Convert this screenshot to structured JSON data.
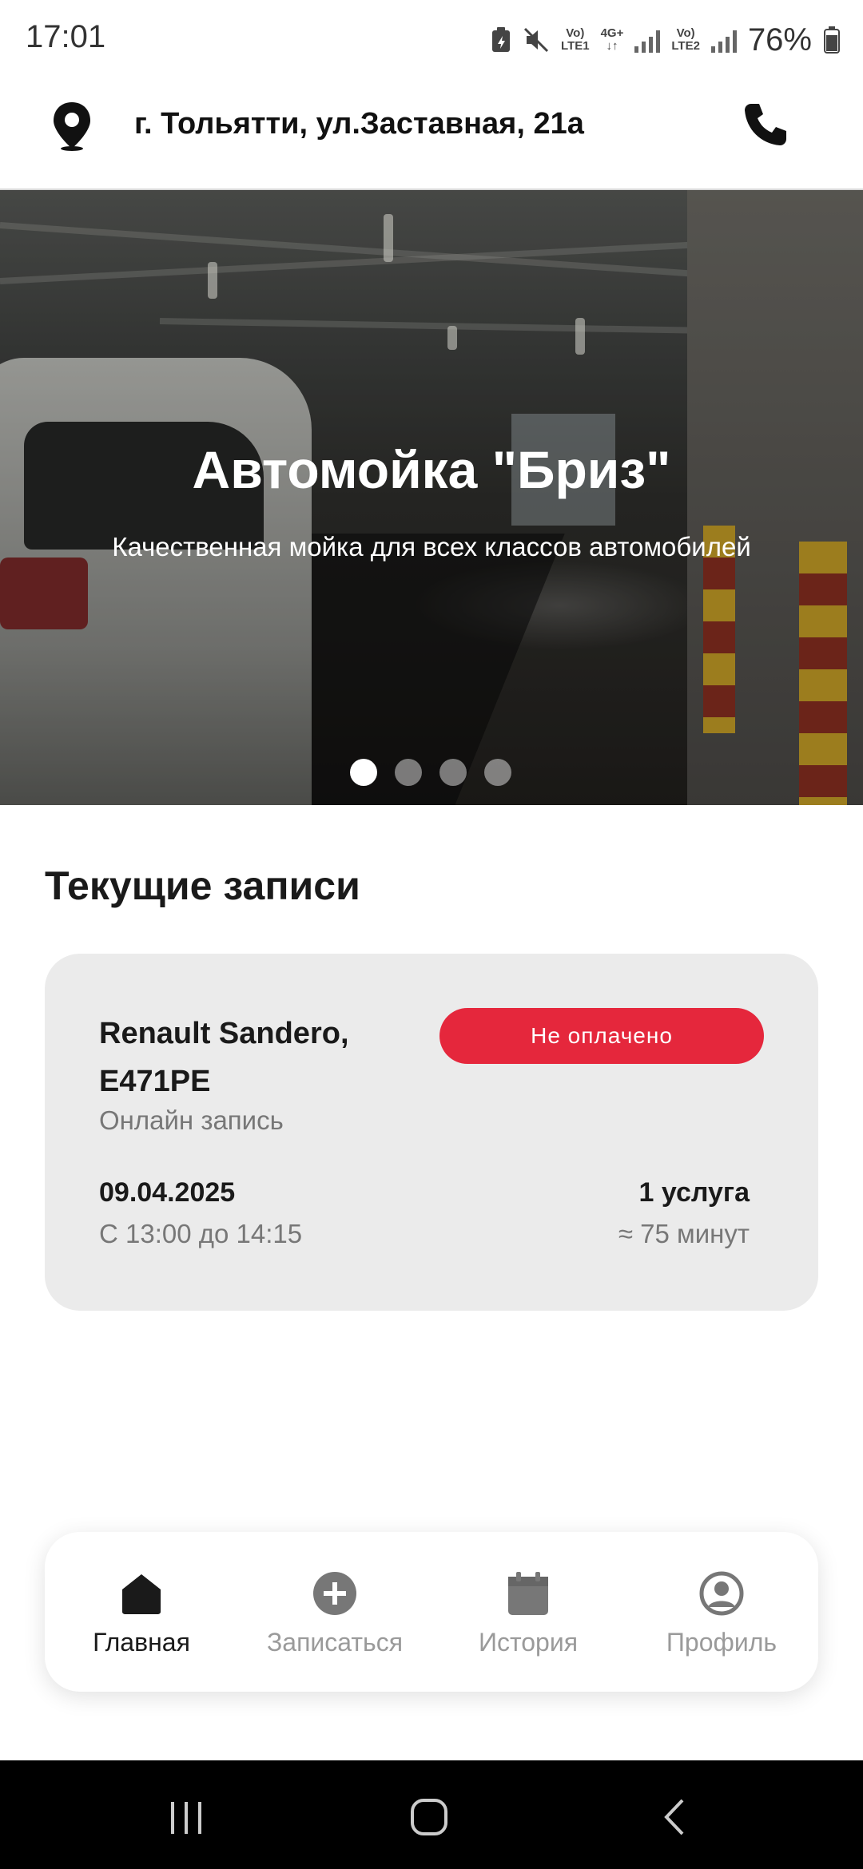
{
  "status_bar": {
    "time": "17:01",
    "net1_top": "Vo)",
    "net1_bottom": "LTE1",
    "net_mid_top": "4G+",
    "net_mid_bottom": "↓↑",
    "net2_top": "Vo)",
    "net2_bottom": "LTE2",
    "battery": "76%",
    "icons": [
      "battery-saver-icon",
      "mute-icon",
      "signal-icon",
      "battery-icon"
    ]
  },
  "header": {
    "address": "г. Тольятти, ул.Заставная, 21а",
    "location_icon": "map-pin-icon",
    "phone_icon": "phone-icon"
  },
  "hero": {
    "title": "Автомойка \"Бриз\"",
    "subtitle": "Качественная мойка для всех классов автомобилей",
    "slides_total": 4,
    "active_slide": 1
  },
  "current_bookings": {
    "title": "Текущие записи",
    "items": [
      {
        "car": "Renault Sandero, Е471РЕ",
        "type": "Онлайн запись",
        "status": "Не оплачено",
        "status_color": "#e5273c",
        "date": "09.04.2025",
        "time": "С 13:00 до 14:15",
        "services": "1 услуга",
        "duration": "≈ 75 минут"
      }
    ]
  },
  "bottom_nav": {
    "items": [
      {
        "label": "Главная",
        "icon": "home-icon",
        "active": true
      },
      {
        "label": "Записаться",
        "icon": "plus-circle-icon",
        "active": false
      },
      {
        "label": "История",
        "icon": "calendar-icon",
        "active": false
      },
      {
        "label": "Профиль",
        "icon": "profile-icon",
        "active": false
      }
    ]
  },
  "system_nav": {
    "buttons": [
      "recent-apps-icon",
      "home-circle-icon",
      "back-icon"
    ]
  }
}
